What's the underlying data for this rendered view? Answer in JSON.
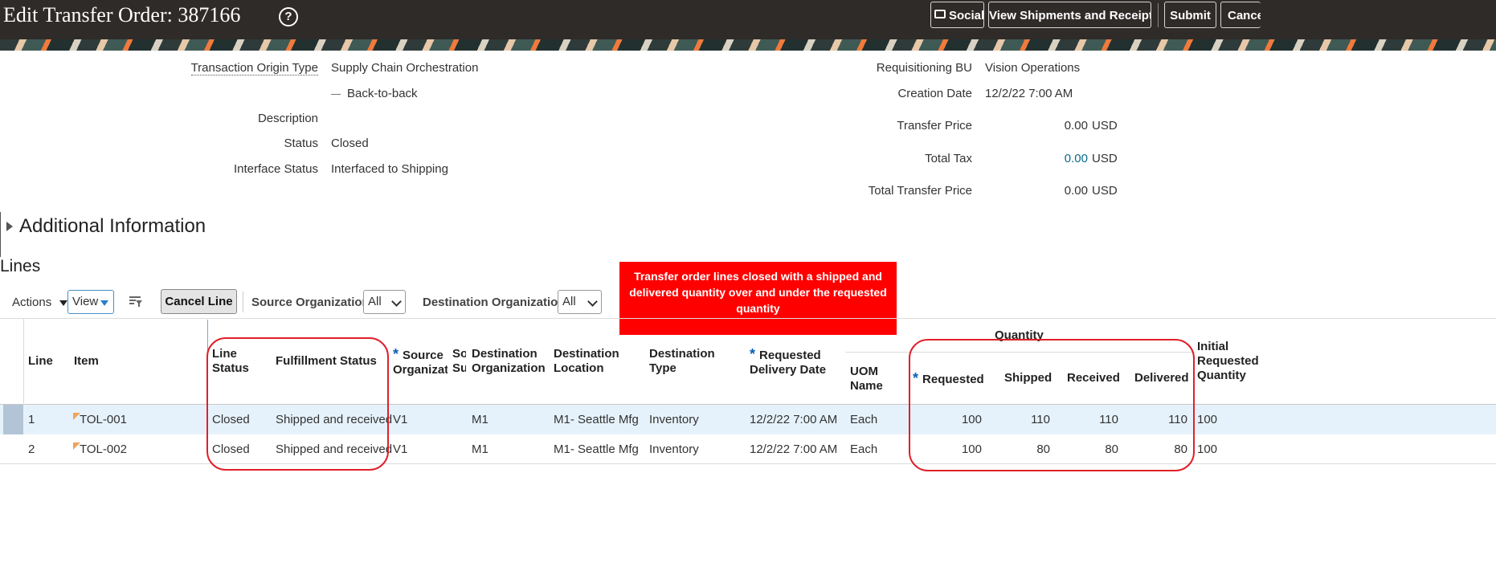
{
  "header": {
    "title": "Edit Transfer Order: 387166",
    "buttons": {
      "social": "Social",
      "view_shipments": "View Shipments and Receipts",
      "submit": "Submit",
      "cancel": "Cancel"
    }
  },
  "form": {
    "transaction_origin_type_label": "Transaction Origin Type",
    "transaction_origin_type_value": "Supply Chain Orchestration",
    "sub_origin_value": "Back-to-back",
    "description_label": "Description",
    "status_label": "Status",
    "status_value": "Closed",
    "interface_status_label": "Interface Status",
    "interface_status_value": "Interfaced to Shipping",
    "requisitioning_bu_label": "Requisitioning BU",
    "requisitioning_bu_value": "Vision Operations",
    "creation_date_label": "Creation Date",
    "creation_date_value": "12/2/22 7:00 AM",
    "transfer_price_label": "Transfer Price",
    "transfer_price_value": "0.00",
    "total_tax_label": "Total Tax",
    "total_tax_value": "0.00",
    "total_transfer_price_label": "Total Transfer Price",
    "total_transfer_price_value": "0.00",
    "currency": "USD"
  },
  "sections": {
    "additional_info": "Additional Information",
    "lines": "Lines"
  },
  "toolbar": {
    "actions": "Actions",
    "view": "View",
    "cancel_line": "Cancel Line",
    "source_org_label": "Source Organization",
    "source_org_value": "All",
    "dest_org_label": "Destination Organization",
    "dest_org_value": "All"
  },
  "callout": "Transfer order lines closed with a shipped and delivered quantity over and under the requested quantity",
  "table": {
    "headers": {
      "line": "Line",
      "item": "Item",
      "line_status": "Line\nStatus",
      "fulfillment_status": "Fulfillment Status",
      "source_org": "Source\nOrganization",
      "source_sub": "Source\nSubinventory",
      "dest_org": "Destination\nOrganization",
      "dest_loc": "Destination\nLocation",
      "dest_type": "Destination\nType",
      "req_delivery_date": "Requested\nDelivery Date",
      "quantity_group": "Quantity",
      "uom_name": "UOM\nName",
      "requested": "Requested",
      "shipped": "Shipped",
      "received": "Received",
      "delivered": "Delivered",
      "initial_req_qty": "Initial\nRequested\nQuantity"
    },
    "rows": [
      {
        "line": "1",
        "item": "TOL-001",
        "line_status": "Closed",
        "fulfillment_status": "Shipped and received",
        "source_org": "V1",
        "dest_org": "M1",
        "dest_loc": "M1- Seattle Mfg",
        "dest_type": "Inventory",
        "req_delivery_date": "12/2/22 7:00 AM",
        "uom": "Each",
        "requested": "100",
        "shipped": "110",
        "received": "110",
        "delivered": "110",
        "initial_req_qty": "100"
      },
      {
        "line": "2",
        "item": "TOL-002",
        "line_status": "Closed",
        "fulfillment_status": "Shipped and received",
        "source_org": "V1",
        "dest_org": "M1",
        "dest_loc": "M1- Seattle Mfg",
        "dest_type": "Inventory",
        "req_delivery_date": "12/2/22 7:00 AM",
        "uom": "Each",
        "requested": "100",
        "shipped": "80",
        "received": "80",
        "delivered": "80",
        "initial_req_qty": "100"
      }
    ]
  }
}
